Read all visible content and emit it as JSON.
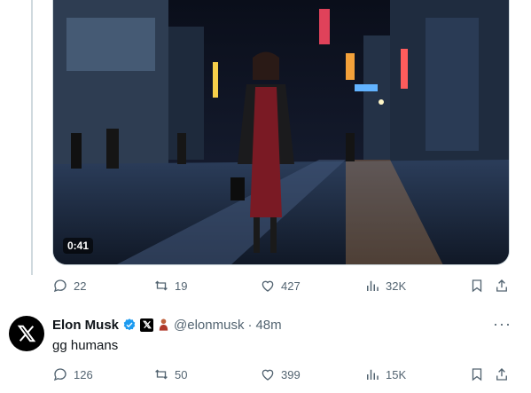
{
  "tweet1": {
    "video": {
      "duration": "0:41"
    },
    "stats": {
      "replies": "22",
      "reposts": "19",
      "likes": "427",
      "views": "32K"
    }
  },
  "tweet2": {
    "author_name": "Elon Musk",
    "handle": "@elonmusk",
    "separator": "·",
    "time": "48m",
    "text": "gg humans",
    "stats": {
      "replies": "126",
      "reposts": "50",
      "likes": "399",
      "views": "15K"
    }
  },
  "colors": {
    "secondary_text": "#536471",
    "verified_blue": "#1d9bf0",
    "divider": "#cfd9de"
  }
}
